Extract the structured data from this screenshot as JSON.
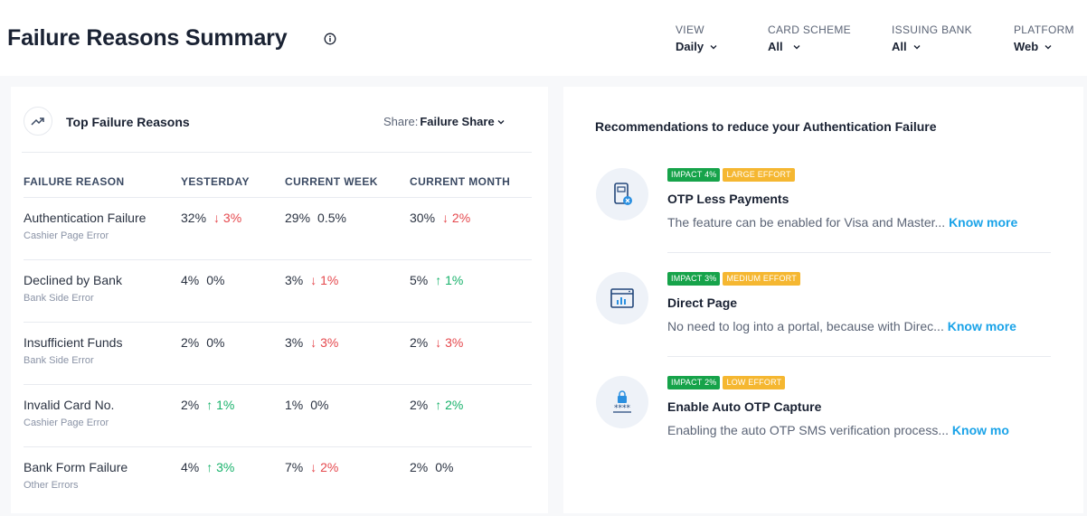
{
  "header": {
    "title": "Failure Reasons Summary",
    "filters": [
      {
        "label": "VIEW",
        "value": "Daily"
      },
      {
        "label": "CARD SCHEME",
        "value": "All"
      },
      {
        "label": "ISSUING BANK",
        "value": "All"
      },
      {
        "label": "PLATFORM",
        "value": "Web"
      }
    ]
  },
  "failure_panel": {
    "title": "Top Failure Reasons",
    "share_label": "Share:",
    "share_value": "Failure Share",
    "columns": [
      "FAILURE REASON",
      "YESTERDAY",
      "CURRENT WEEK",
      "CURRENT MONTH"
    ],
    "rows": [
      {
        "reason": "Authentication Failure",
        "category": "Cashier Page Error",
        "yesterday": {
          "pct": "32%",
          "change": "3%",
          "dir": "down"
        },
        "week": {
          "pct": "29%",
          "change": "0.5%",
          "dir": "flat"
        },
        "month": {
          "pct": "30%",
          "change": "2%",
          "dir": "down"
        }
      },
      {
        "reason": "Declined by Bank",
        "category": "Bank Side Error",
        "yesterday": {
          "pct": "4%",
          "change": "0%",
          "dir": "flat"
        },
        "week": {
          "pct": "3%",
          "change": "1%",
          "dir": "down"
        },
        "month": {
          "pct": "5%",
          "change": "1%",
          "dir": "up"
        }
      },
      {
        "reason": "Insufficient Funds",
        "category": "Bank Side Error",
        "yesterday": {
          "pct": "2%",
          "change": "0%",
          "dir": "flat"
        },
        "week": {
          "pct": "3%",
          "change": "3%",
          "dir": "down"
        },
        "month": {
          "pct": "2%",
          "change": "3%",
          "dir": "down"
        }
      },
      {
        "reason": "Invalid Card No.",
        "category": "Cashier Page Error",
        "yesterday": {
          "pct": "2%",
          "change": "1%",
          "dir": "up"
        },
        "week": {
          "pct": "1%",
          "change": "0%",
          "dir": "flat"
        },
        "month": {
          "pct": "2%",
          "change": "2%",
          "dir": "up"
        }
      },
      {
        "reason": "Bank Form Failure",
        "category": "Other Errors",
        "yesterday": {
          "pct": "4%",
          "change": "3%",
          "dir": "up"
        },
        "week": {
          "pct": "7%",
          "change": "2%",
          "dir": "down"
        },
        "month": {
          "pct": "2%",
          "change": "0%",
          "dir": "flat"
        }
      }
    ]
  },
  "recommendations": {
    "title": "Recommendations to reduce your Authentication Failure",
    "items": [
      {
        "impact": "IMPACT 4%",
        "effort": "LARGE EFFORT",
        "name": "OTP Less Payments",
        "description": "The feature can be enabled for Visa and Master...",
        "link": "Know more",
        "icon": "phone-otp-icon"
      },
      {
        "impact": "IMPACT 3%",
        "effort": "MEDIUM EFFORT",
        "name": "Direct Page",
        "description": "No need to log into a portal, because with Direc...",
        "link": "Know more",
        "icon": "browser-chart-icon"
      },
      {
        "impact": "IMPACT 2%",
        "effort": "LOW EFFORT",
        "name": "Enable Auto OTP Capture",
        "description": "Enabling the auto OTP SMS verification process...",
        "link": "Know mo",
        "icon": "lock-password-icon"
      }
    ]
  },
  "colors": {
    "down": "#e5484d",
    "up": "#18b26b",
    "link": "#1aa3e8",
    "impact": "#16a34a",
    "effort": "#f5b731"
  }
}
